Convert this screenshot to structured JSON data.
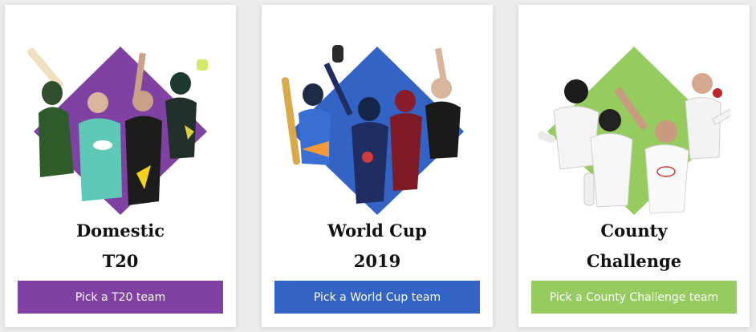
{
  "cards": [
    {
      "title_line1": "Domestic",
      "title_line2": "T20",
      "button_label": "Pick a T20 team",
      "accent": "#7f42a3",
      "illustration": "t20-players-illustration"
    },
    {
      "title_line1": "World Cup",
      "title_line2": "2019",
      "button_label": "Pick a World Cup team",
      "accent": "#3363c4",
      "illustration": "world-cup-players-illustration"
    },
    {
      "title_line1": "County",
      "title_line2": "Challenge",
      "button_label": "Pick a County Challenge team",
      "accent": "#95cb5f",
      "illustration": "county-players-illustration"
    }
  ]
}
